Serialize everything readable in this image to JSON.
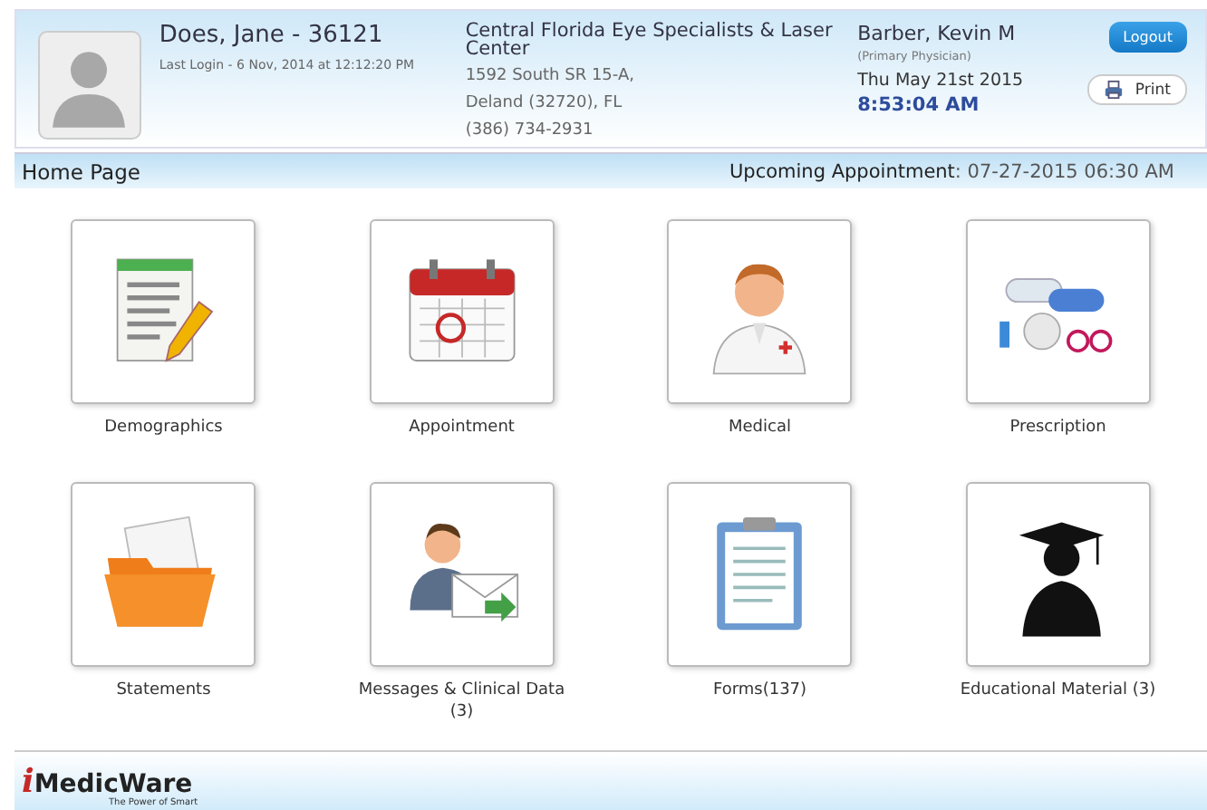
{
  "patient": {
    "name": "Does, Jane - 36121",
    "last_login": "Last Login - 6 Nov, 2014 at 12:12:20 PM"
  },
  "practice": {
    "name": "Central Florida Eye Specialists & Laser Center",
    "address_line_1": "1592 South SR 15-A,",
    "address_line_2": "Deland (32720), FL",
    "phone": "(386) 734-2931"
  },
  "physician": {
    "name": "Barber, Kevin M",
    "role": "(Primary Physician)",
    "date": "Thu May 21st 2015",
    "time": "8:53:04 AM"
  },
  "buttons": {
    "logout": "Logout",
    "print": "Print"
  },
  "page_bar": {
    "title": "Home Page",
    "appointment_label": "Upcoming Appointment",
    "appointment_value": ": 07-27-2015 06:30 AM"
  },
  "tiles": [
    {
      "kind": "document",
      "label": "Demographics"
    },
    {
      "kind": "calendar",
      "label": "Appointment"
    },
    {
      "kind": "doctor",
      "label": "Medical"
    },
    {
      "kind": "pills",
      "label": "Prescription"
    },
    {
      "kind": "folder",
      "label": "Statements"
    },
    {
      "kind": "envelope",
      "label": "Messages & Clinical Data (3)"
    },
    {
      "kind": "clipboard",
      "label": "Forms(137)"
    },
    {
      "kind": "graduate",
      "label": "Educational Material (3)"
    }
  ],
  "footer": {
    "logo_mark": "i",
    "logo_text": "MedicWare",
    "tagline": "The Power of Smart"
  }
}
